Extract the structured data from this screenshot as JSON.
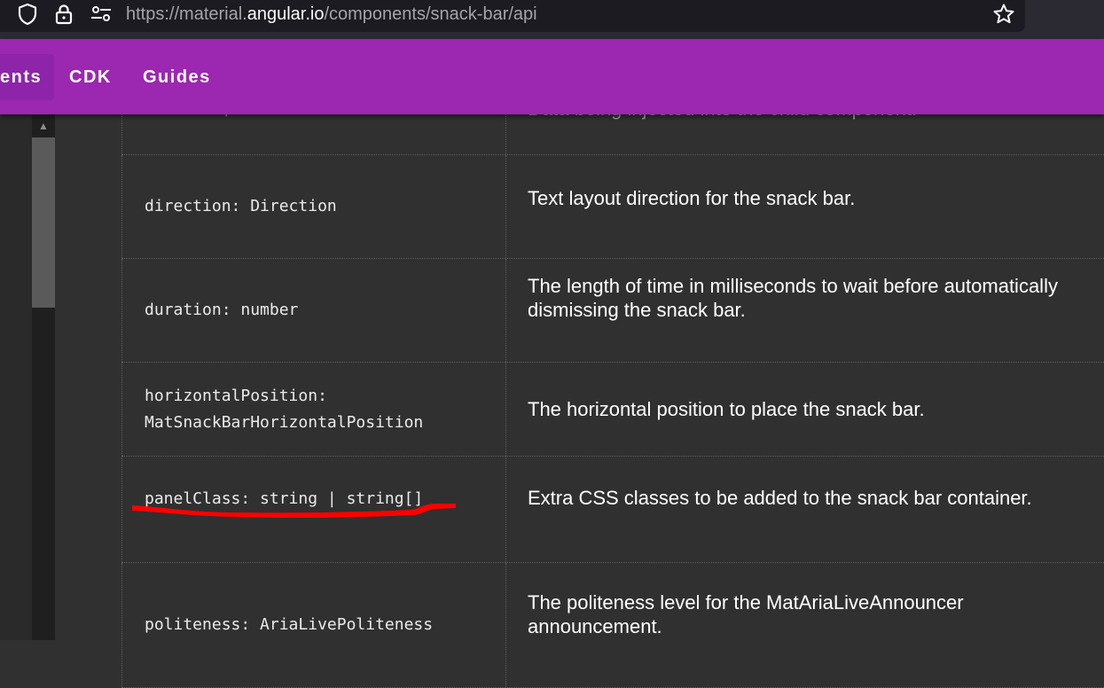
{
  "browser": {
    "url_prefix": "https://material.",
    "url_host": "angular.io",
    "url_path": "/components/snack-bar/api"
  },
  "toolbar": {
    "nav_items": [
      {
        "label": "ents",
        "active": true
      },
      {
        "label": "CDK",
        "active": false
      },
      {
        "label": "Guides",
        "active": false
      }
    ],
    "accent": "#9c27b0"
  },
  "api_table": {
    "rows": [
      {
        "name": "data: D | null",
        "description": "Data being injected into the child component."
      },
      {
        "name": "direction: Direction",
        "description": "Text layout direction for the snack bar."
      },
      {
        "name": "duration: number",
        "description": "The length of time in milliseconds to wait before automatically dismissing the snack bar."
      },
      {
        "name": "horizontalPosition:\nMatSnackBarHorizontalPosition",
        "description": "The horizontal position to place the snack bar."
      },
      {
        "name": "panelClass: string | string[]",
        "description": "Extra CSS classes to be added to the snack bar container."
      },
      {
        "name": "politeness: AriaLivePoliteness",
        "description": "The politeness level for the MatAriaLiveAnnouncer announcement."
      }
    ]
  },
  "annotation": {
    "color": "#ff0000",
    "marks_row": "panelClass"
  }
}
